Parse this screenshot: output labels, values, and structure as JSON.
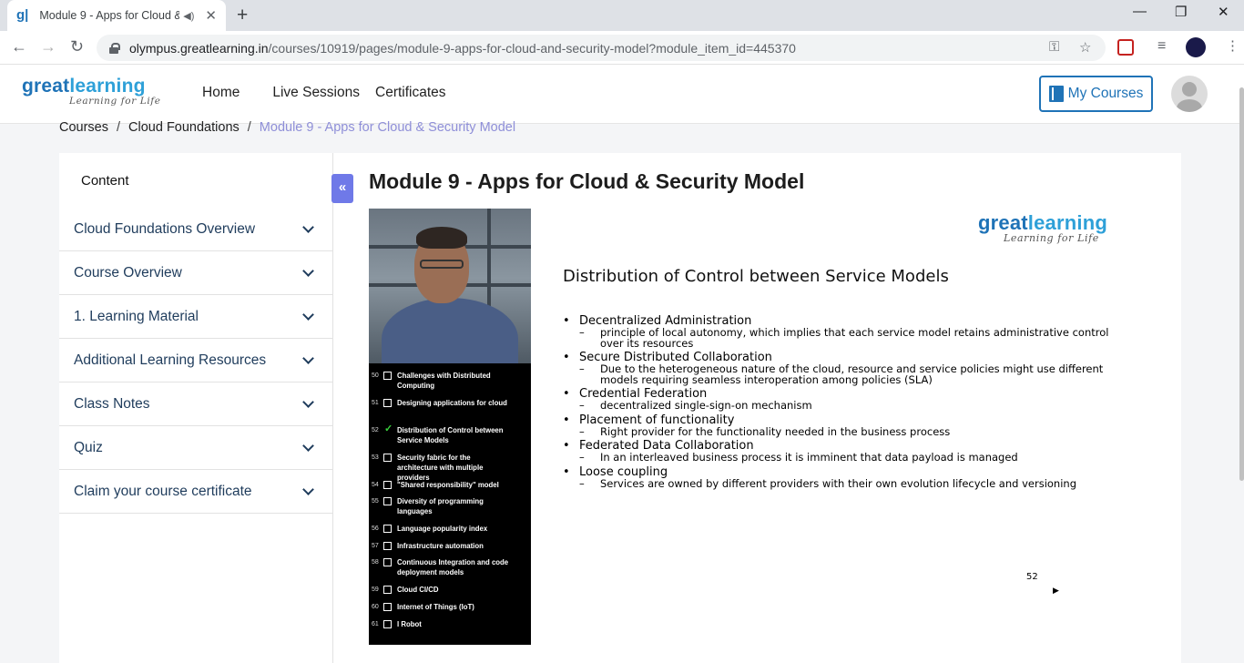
{
  "browser": {
    "tab_title": "Module 9 - Apps for Cloud &",
    "favicon": "gl-icon",
    "url_host": "olympus.greatlearning.in",
    "url_path": "/courses/10919/pages/module-9-apps-for-cloud-and-security-model?module_item_id=445370"
  },
  "header": {
    "logo_great": "great",
    "logo_learning": "learning",
    "logo_tagline": "Learning for Life",
    "nav": [
      "Home",
      "Live Sessions",
      "Certificates"
    ],
    "my_courses": "My Courses"
  },
  "breadcrumb": {
    "items": [
      "Courses",
      "Cloud Foundations"
    ],
    "separator": "/",
    "current": "Module 9 - Apps for Cloud & Security Model"
  },
  "sidebar": {
    "title": "Content",
    "collapse_icon": "«",
    "items": [
      {
        "label": "Cloud Foundations Overview"
      },
      {
        "label": "Course Overview"
      },
      {
        "label": "1. Learning Material"
      },
      {
        "label": "Additional Learning Resources"
      },
      {
        "label": "Class Notes"
      },
      {
        "label": "Quiz"
      },
      {
        "label": "Claim your course certificate"
      }
    ]
  },
  "main": {
    "title": "Module 9 - Apps for Cloud & Security Model"
  },
  "video": {
    "agenda": [
      {
        "num": "50",
        "text": "Challenges with Distributed Computing",
        "checked": false
      },
      {
        "num": "51",
        "text": "Designing applications for cloud",
        "checked": false
      },
      {
        "num": "52",
        "text": "Distribution of Control between Service Models",
        "checked": true
      },
      {
        "num": "53",
        "text": "Security fabric for the architecture with multiple providers",
        "checked": false
      },
      {
        "num": "54",
        "text": "\"Shared responsibility\" model",
        "checked": false
      },
      {
        "num": "55",
        "text": "Diversity of programming languages",
        "checked": false
      },
      {
        "num": "56",
        "text": "Language popularity index",
        "checked": false
      },
      {
        "num": "57",
        "text": "Infrastructure automation",
        "checked": false
      },
      {
        "num": "58",
        "text": "Continuous Integration and code deployment models",
        "checked": false
      },
      {
        "num": "59",
        "text": "Cloud CI/CD",
        "checked": false
      },
      {
        "num": "60",
        "text": "Internet of Things (IoT)",
        "checked": false
      },
      {
        "num": "61",
        "text": "I Robot",
        "checked": false
      }
    ],
    "slide": {
      "logo_great": "great",
      "logo_learning": "learning",
      "logo_tagline": "Learning for Life",
      "title": "Distribution of Control between Service Models",
      "bullets": [
        {
          "text": "Decentralized Administration",
          "sub": [
            "principle of local autonomy, which implies that each service model retains administrative control over its resources"
          ]
        },
        {
          "text": "Secure Distributed Collaboration",
          "sub": [
            "Due to the heterogeneous nature of the cloud, resource and service policies might use different models requiring seamless interoperation among policies (SLA)"
          ]
        },
        {
          "text": "Credential Federation",
          "sub": [
            "decentralized single-sign-on mechanism"
          ]
        },
        {
          "text": "Placement of functionality",
          "sub": [
            "Right provider for the functionality needed in the business process"
          ]
        },
        {
          "text": "Federated Data Collaboration",
          "sub": [
            "In an interleaved business process it is imminent that data payload is managed"
          ]
        },
        {
          "text": "Loose coupling",
          "sub": [
            "Services are owned by different providers with their own evolution lifecycle and versioning"
          ]
        }
      ],
      "page_number": "52"
    }
  }
}
